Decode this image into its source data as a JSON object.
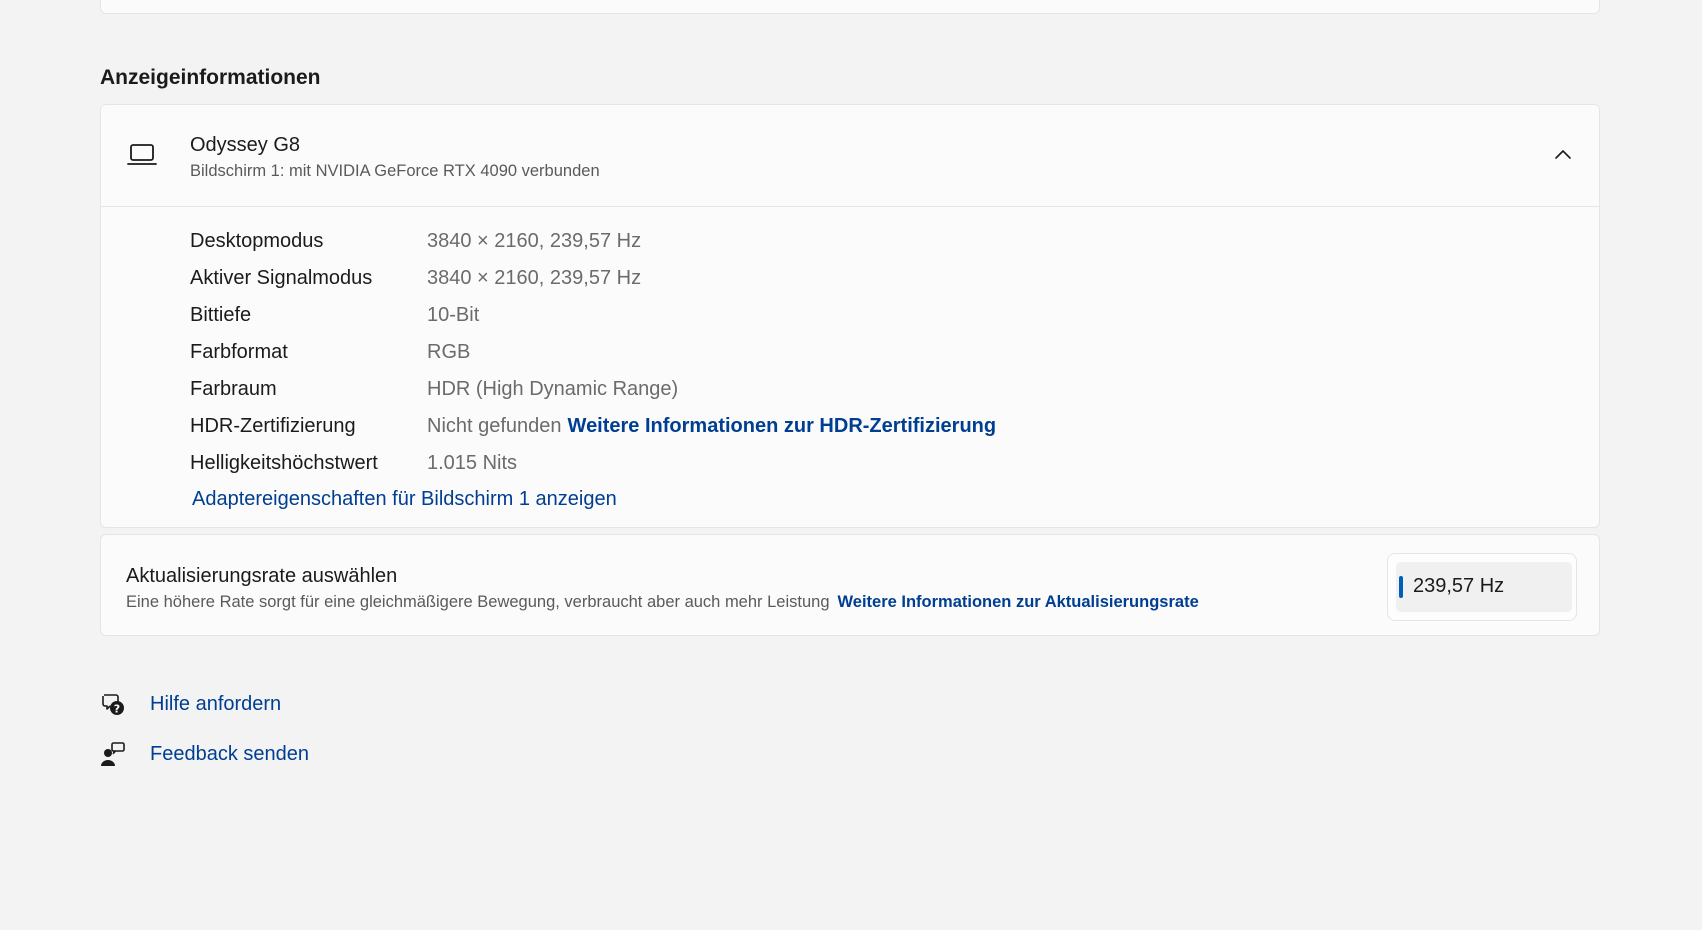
{
  "section": {
    "title": "Anzeigeinformationen"
  },
  "display": {
    "name": "Odyssey G8",
    "subtitle": "Bildschirm 1: mit NVIDIA GeForce RTX 4090 verbunden",
    "icon": "laptop-icon",
    "rows": [
      {
        "label": "Desktopmodus",
        "value": "3840 × 2160, 239,57 Hz"
      },
      {
        "label": "Aktiver Signalmodus",
        "value": "3840 × 2160, 239,57 Hz"
      },
      {
        "label": "Bittiefe",
        "value": "10-Bit"
      },
      {
        "label": "Farbformat",
        "value": "RGB"
      },
      {
        "label": "Farbraum",
        "value": "HDR (High Dynamic Range)"
      },
      {
        "label": "HDR-Zertifizierung",
        "value": "Nicht gefunden",
        "link": "Weitere Informationen zur HDR-Zertifizierung"
      },
      {
        "label": "Helligkeitshöchstwert",
        "value": "1.015 Nits"
      }
    ],
    "adapter_link": "Adaptereigenschaften für Bildschirm 1 anzeigen"
  },
  "refresh": {
    "title": "Aktualisierungsrate auswählen",
    "description": "Eine höhere Rate sorgt für eine gleichmäßigere Bewegung, verbraucht aber auch mehr Leistung",
    "link": "Weitere Informationen zur Aktualisierungsrate",
    "selected": "239,57 Hz"
  },
  "footer": {
    "help": "Hilfe anfordern",
    "feedback": "Feedback senden"
  },
  "colors": {
    "accent": "#005fb8",
    "link": "#003e92",
    "background": "#f3f3f3",
    "card": "#fbfbfb"
  }
}
